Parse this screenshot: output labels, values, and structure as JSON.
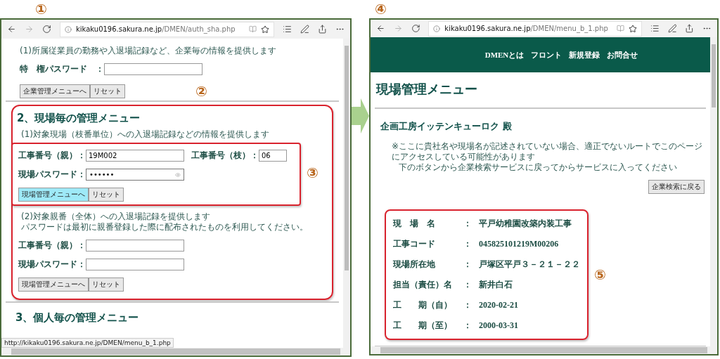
{
  "left_window": {
    "marker": "①",
    "address": {
      "host": "kikaku0196.sakura.ne.jp",
      "path": "/DMEN/auth_sha.php"
    },
    "section_1": {
      "note": "(1)所属従業員の勤務や入退場記録など、企業毎の情報を提供します",
      "fields": [
        {
          "label": "特　権パスワード　：",
          "kind": "text"
        }
      ],
      "buttons": [
        {
          "label": "企業管理メニューへ",
          "highlighted": false
        },
        {
          "label": "リセット",
          "highlighted": false
        }
      ],
      "marker": "②"
    },
    "section_2": {
      "heading": "2、現場毎の管理メニュー",
      "part_1": {
        "note": "(1)対象現場（枝番単位）への入退場記録などの情報を提供します",
        "marker": "③",
        "rows": [
          {
            "fields": [
              {
                "label": "工事番号（親）：",
                "kind": "text",
                "value": "19M002"
              },
              {
                "label": "工事番号（枝）：",
                "kind": "short",
                "value": "06"
              }
            ]
          },
          {
            "fields": [
              {
                "label": "現場パスワード：",
                "kind": "password",
                "value": "••••••"
              }
            ]
          }
        ],
        "buttons": [
          {
            "label": "現場管理メニューへ",
            "highlighted": true
          },
          {
            "label": "リセット",
            "highlighted": false
          }
        ]
      },
      "part_2": {
        "notes": [
          "(2)対象親番（全体）への入退場記録を提供します",
          "パスワードは最初に親番登録した際に配布されたものを利用してください。"
        ],
        "rows": [
          {
            "fields": [
              {
                "label": "工事番号（親）：",
                "kind": "text"
              }
            ]
          },
          {
            "fields": [
              {
                "label": "現場パスワード：",
                "kind": "text"
              }
            ]
          }
        ],
        "buttons": [
          {
            "label": "現場管理メニューへ",
            "highlighted": false
          },
          {
            "label": "リセット",
            "highlighted": false
          }
        ]
      }
    },
    "section_3": {
      "heading": "3、個人毎の管理メニュー"
    },
    "status_url": "http://kikaku0196.sakura.ne.jp/DMEN/menu_b_1.php"
  },
  "right_window": {
    "marker": "④",
    "address": {
      "host": "kikaku0196.sakura.ne.jp",
      "path": "/DMEN/menu_b_1.php"
    },
    "nav": [
      "DMENとは",
      "フロント",
      "新規登録",
      "お問合せ"
    ],
    "heading": "現場管理メニュー",
    "company": "企画工房イッテンキューロク 殿",
    "notices": [
      "※ここに貴社名や現場名が記述されていない場合、適正でないルートでこのページにアクセスしている可能性があります",
      "下のボタンから企業検索サービスに戻ってからサービスに入ってください"
    ],
    "back_button": "企業検索に戻る",
    "info": {
      "marker": "⑤",
      "rows": [
        {
          "label": "現　場　名",
          "colon": "：",
          "value": "平戸幼稚園改築内装工事",
          "kind": "text"
        },
        {
          "label": "工事コード",
          "colon": "：",
          "value": "045825101219M00206",
          "kind": "code"
        },
        {
          "label": "現場所在地",
          "colon": "：",
          "value": "戸塚区平戸３－２１－２２",
          "kind": "text"
        },
        {
          "label": "担当（責任）名",
          "colon": "：",
          "value": "新井白石",
          "kind": "text"
        },
        {
          "label": "工　　期（自）",
          "colon": "：",
          "value": "2020-02-21",
          "kind": "code"
        },
        {
          "label": "工　　期（至）",
          "colon": "：",
          "value": "2000-03-31",
          "kind": "code"
        }
      ]
    }
  }
}
